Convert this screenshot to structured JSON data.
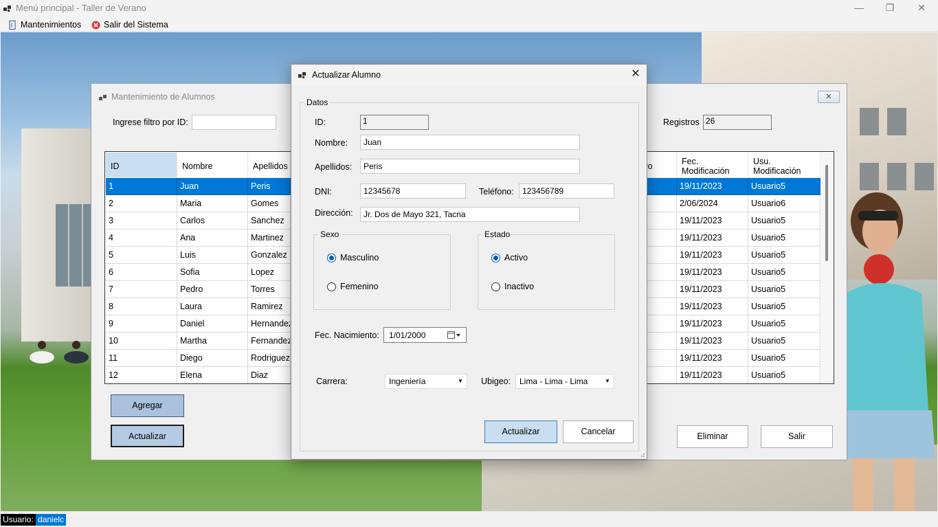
{
  "window": {
    "title": "Menú principal - Taller de Verano",
    "minimize": "—",
    "restore": "❐",
    "close": "✕"
  },
  "menu": {
    "items": [
      {
        "label": "Mantenimientos",
        "icon": "book-icon"
      },
      {
        "label": "Salir del Sistema",
        "icon": "exit-icon"
      }
    ]
  },
  "parent_form": {
    "title": "Mantenimiento de Alumnos",
    "close": "✕",
    "filter_label": "Ingrese filtro por ID:",
    "filter_value": "",
    "records_label": "Registros",
    "records_value": "26",
    "grid": {
      "columns": [
        "ID",
        "Nombre",
        "Apellidos",
        "tro",
        "Fec.\nModificación",
        "Usu.\nModificación"
      ],
      "rows": [
        {
          "id": "1",
          "nombre": "Juan",
          "apellidos": "Peris",
          "fec": "19/11/2023",
          "usu": "Usuario5"
        },
        {
          "id": "2",
          "nombre": "Maria",
          "apellidos": "Gomes",
          "fec": "2/06/2024",
          "usu": "Usuario6"
        },
        {
          "id": "3",
          "nombre": "Carlos",
          "apellidos": "Sanchez",
          "fec": "19/11/2023",
          "usu": "Usuario5"
        },
        {
          "id": "4",
          "nombre": "Ana",
          "apellidos": "Martinez",
          "fec": "19/11/2023",
          "usu": "Usuario5"
        },
        {
          "id": "5",
          "nombre": "Luis",
          "apellidos": "Gonzalez",
          "fec": "19/11/2023",
          "usu": "Usuario5"
        },
        {
          "id": "6",
          "nombre": "Sofia",
          "apellidos": "Lopez",
          "fec": "19/11/2023",
          "usu": "Usuario5"
        },
        {
          "id": "7",
          "nombre": "Pedro",
          "apellidos": "Torres",
          "fec": "19/11/2023",
          "usu": "Usuario5"
        },
        {
          "id": "8",
          "nombre": "Laura",
          "apellidos": "Ramirez",
          "fec": "19/11/2023",
          "usu": "Usuario5"
        },
        {
          "id": "9",
          "nombre": "Daniel",
          "apellidos": "Hernandez",
          "fec": "19/11/2023",
          "usu": "Usuario5"
        },
        {
          "id": "10",
          "nombre": "Martha",
          "apellidos": "Fernandez",
          "fec": "19/11/2023",
          "usu": "Usuario5"
        },
        {
          "id": "11",
          "nombre": "Diego",
          "apellidos": "Rodriguez",
          "fec": "19/11/2023",
          "usu": "Usuario5"
        },
        {
          "id": "12",
          "nombre": "Elena",
          "apellidos": "Diaz",
          "fec": "19/11/2023",
          "usu": "Usuario5"
        }
      ]
    },
    "buttons": {
      "agregar": "Agregar",
      "actualizar": "Actualizar",
      "eliminar": "Eliminar",
      "salir": "Salir"
    }
  },
  "dialog": {
    "title": "Actualizar Alumno",
    "close": "✕",
    "group_datos": "Datos",
    "id_label": "ID:",
    "id_value": "1",
    "nombre_label": "Nombre:",
    "nombre_value": "Juan",
    "apellidos_label": "Apellidos:",
    "apellidos_value": "Peris",
    "dni_label": "DNI:",
    "dni_value": "12345678",
    "telefono_label": "Teléfono:",
    "telefono_value": "123456789",
    "direccion_label": "Dirección:",
    "direccion_value": "Jr. Dos de Mayo 321, Tacna",
    "sexo": {
      "title": "Sexo",
      "options": [
        "Masculino",
        "Femenino"
      ],
      "selected": "Masculino"
    },
    "estado": {
      "title": "Estado",
      "options": [
        "Activo",
        "Inactivo"
      ],
      "selected": "Activo"
    },
    "fec_nac_label": "Fec. Nacimiento:",
    "fec_nac_value": "1/01/2000",
    "carrera_label": "Carrera:",
    "carrera_value": "Ingeniería",
    "ubigeo_label": "Ubigeo:",
    "ubigeo_value": "Lima - Lima - Lima",
    "actualizar_button": "Actualizar",
    "cancelar_button": "Cancelar"
  },
  "status": {
    "label": "Usuario:",
    "user": "danielc"
  },
  "colors": {
    "selection": "#0078d7",
    "accent_button": "#a9c1dc"
  }
}
